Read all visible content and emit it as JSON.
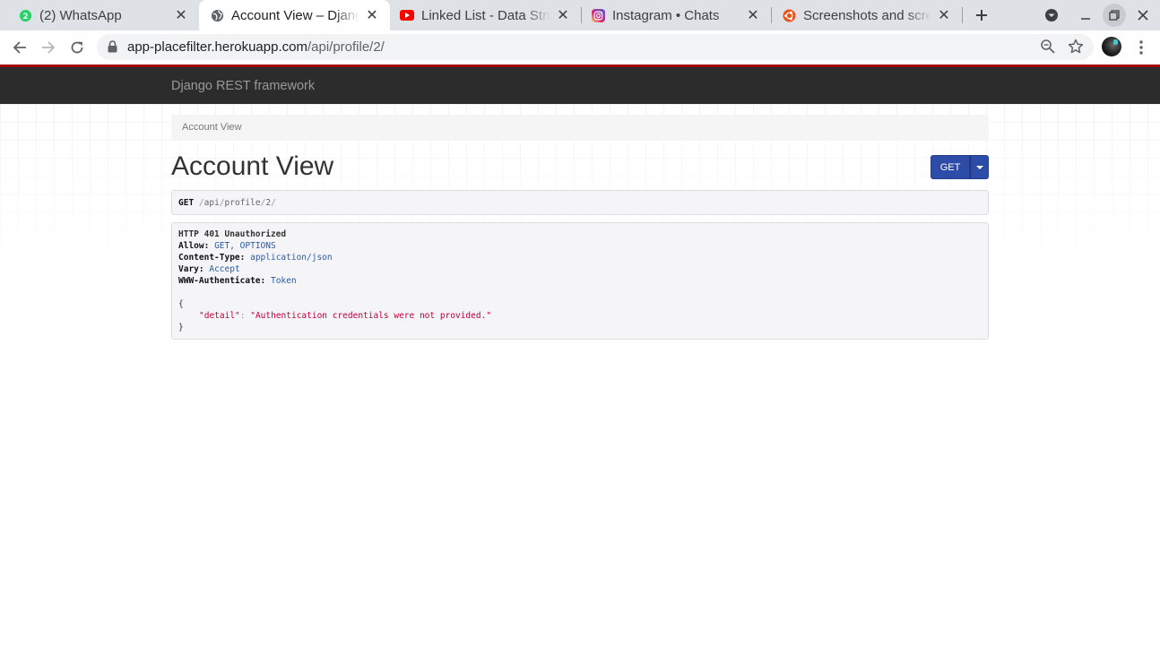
{
  "browser": {
    "tabs": [
      {
        "title": "(2) WhatsApp",
        "icon": "whatsapp-icon",
        "active": false
      },
      {
        "title": "Account View – Django REST framework",
        "icon": "globe-icon",
        "active": true
      },
      {
        "title": "Linked List - Data Structures",
        "icon": "youtube-icon",
        "active": false
      },
      {
        "title": "Instagram • Chats",
        "icon": "instagram-icon",
        "active": false
      },
      {
        "title": "Screenshots and screen recordings",
        "icon": "ubuntu-icon",
        "active": false
      }
    ],
    "address": {
      "host": "app-placefilter.herokuapp.com",
      "path": "/api/profile/2/"
    }
  },
  "site": {
    "brand": "Django REST framework",
    "breadcrumb": "Account View",
    "title": "Account View",
    "get_button": "GET"
  },
  "request": {
    "method": "GET",
    "path_parts": [
      "api",
      "profile",
      "2"
    ]
  },
  "response": {
    "status": "HTTP 401 Unauthorized",
    "headers": [
      {
        "name": "Allow",
        "value": "GET, OPTIONS"
      },
      {
        "name": "Content-Type",
        "value": "application/json"
      },
      {
        "name": "Vary",
        "value": "Accept"
      },
      {
        "name": "WWW-Authenticate",
        "value": "Token"
      }
    ],
    "body": {
      "open": "{",
      "key": "\"detail\"",
      "value": "\"Authentication credentials were not provided.\"",
      "close": "}"
    }
  },
  "colors": {
    "navbar": "#2c2c2c",
    "navbar_accent": "#a30000",
    "get_button": "#2c4ca8",
    "string_value": "#c0003a",
    "header_value": "#2a5ba8"
  }
}
